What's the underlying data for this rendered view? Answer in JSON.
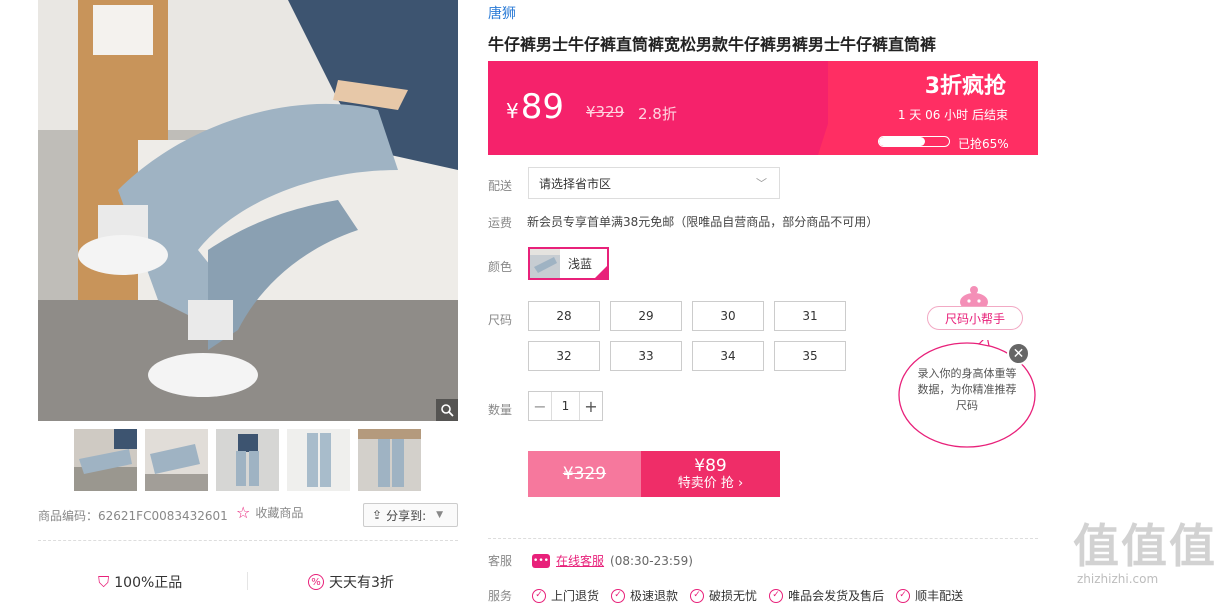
{
  "product": {
    "brand": "唐狮",
    "title": "牛仔裤男士牛仔裤直筒裤宽松男款牛仔裤男裤男士牛仔裤直筒裤",
    "code_label": "商品编码：62621FC0083432601",
    "favorite_label": "收藏商品",
    "share_label": "分享到:"
  },
  "price": {
    "currency": "¥",
    "current": "89",
    "original": "¥329",
    "discount": "2.8折",
    "flash_title": "3折疯抢",
    "countdown": "1 天 06 小时 后结束",
    "sold_percent": 65,
    "sold_label": "已抢65%"
  },
  "delivery": {
    "label": "配送",
    "placeholder": "请选择省市区"
  },
  "shipping": {
    "label": "运费",
    "text": "新会员专享首单满38元免邮（限唯品自营商品，部分商品不可用）"
  },
  "color": {
    "label": "颜色",
    "selected": "浅蓝"
  },
  "size": {
    "label": "尺码",
    "options": [
      "28",
      "29",
      "30",
      "31",
      "32",
      "33",
      "34",
      "35"
    ]
  },
  "quantity": {
    "label": "数量",
    "value": "1",
    "minus": "−",
    "plus": "+"
  },
  "buy": {
    "original": "¥329",
    "price": "¥89",
    "cta": "特卖价 抢 ›"
  },
  "service": {
    "cs_label": "客服",
    "cs_link": "在线客服",
    "cs_hours": "(08:30-23:59)",
    "label": "服务",
    "items": [
      "上门退货",
      "极速退款",
      "破损无忧",
      "唯品会发货及售后",
      "顺丰配送"
    ]
  },
  "guarantees": [
    "100%正品",
    "天天有3折"
  ],
  "size_helper": {
    "title": "尺码小帮手",
    "text": "录入你的身高体重等数据，为你精准推荐尺码"
  },
  "watermark": {
    "big": "值值值",
    "small": "zhizhizhi.com"
  },
  "colors": {
    "accent": "#e8217a",
    "banner": "#f5226b",
    "brand_link": "#2b7bd6"
  }
}
